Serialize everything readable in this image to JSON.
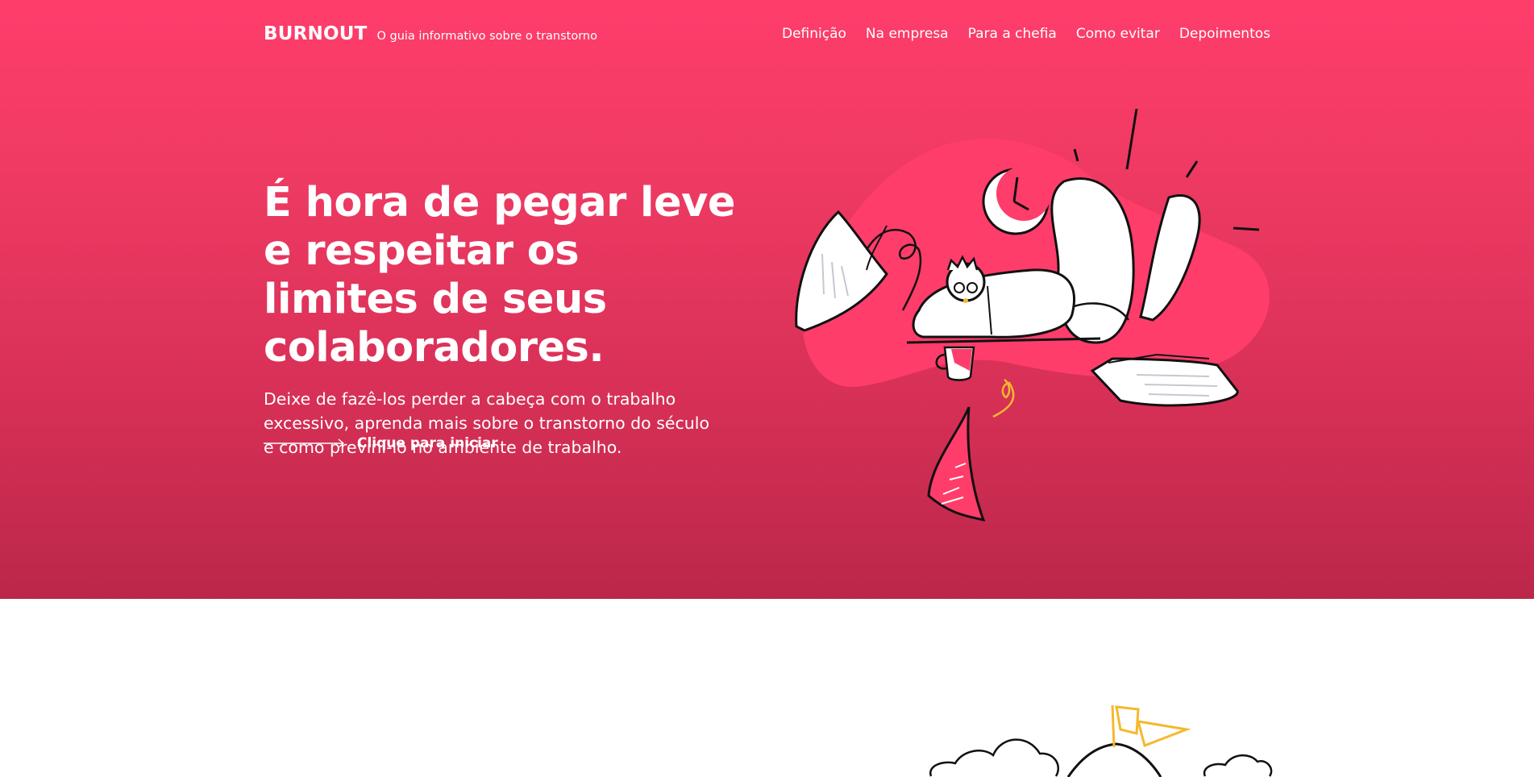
{
  "brand": {
    "logo": "BURNOUT",
    "tagline": "O guia informativo sobre o transtorno"
  },
  "nav": {
    "items": [
      {
        "label": "Definição"
      },
      {
        "label": "Na empresa"
      },
      {
        "label": "Para a chefia"
      },
      {
        "label": "Como evitar"
      },
      {
        "label": "Depoimentos"
      }
    ]
  },
  "hero": {
    "title": "É hora de pegar leve e respeitar os limites de seus colaboradores.",
    "subtitle": "Deixe de fazê-los perder a cabeça com o trabalho excessivo, aprenda mais sobre o transtorno do século e como previní-lo no ambiente de trabalho.",
    "cta_label": "Clique para iniciar"
  },
  "colors": {
    "hero_gradient_top": "#ff3d6b",
    "hero_gradient_bottom": "#bb2749",
    "blob": "#ff3d6b",
    "accent_yellow": "#f5b82e",
    "ink": "#111111",
    "page_background": "#ffffff"
  },
  "icons": {
    "cta_arrow": "long-arrow-right-icon",
    "hero_illustration": "stressed-worker-illustration",
    "bottom_illustration": "mountain-flag-clouds-illustration"
  }
}
